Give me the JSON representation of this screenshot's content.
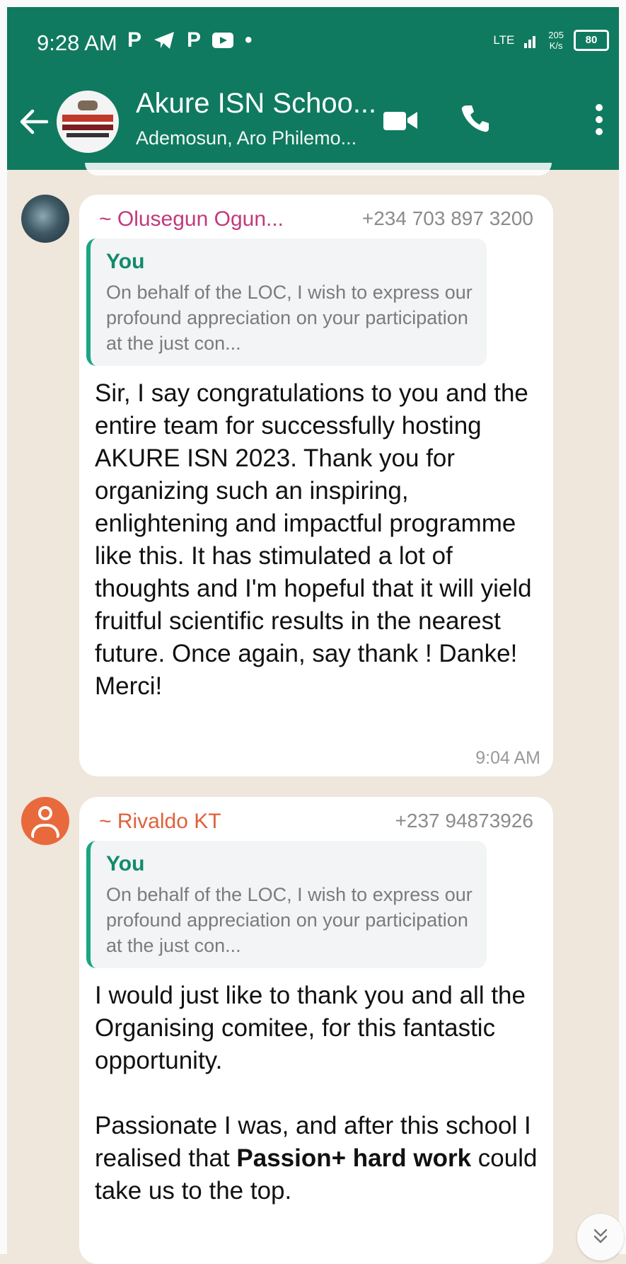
{
  "status_bar": {
    "time": "9:28 AM",
    "notif_p1": "P",
    "notif_p2": "P",
    "notif_dot": "•",
    "network": "LTE",
    "speed": "205",
    "speed_unit": "K/s",
    "battery": "80"
  },
  "chat": {
    "title": "Akure ISN Schoo...",
    "subtitle": "Ademosun, Aro Philemo..."
  },
  "messages": [
    {
      "sender": "~ Olusegun Ogun...",
      "phone": "+234 703 897 3200",
      "sender_color": "#c2397c",
      "quote_author": "You",
      "quote_text": "On behalf of the LOC, I wish to express our profound appreciation on your participation at the just con...",
      "body": "Sir, I say congratulations to you and the entire team for successfully  hosting AKURE ISN 2023. Thank you for organizing such an inspiring, enlightening and impactful programme like this. It has stimulated a lot of thoughts and I'm hopeful that it will yield fruitful scientific results in the nearest future. Once again, say thank ! Danke! Merci!",
      "time": "9:04 AM"
    },
    {
      "sender": "~ Rivaldo KT",
      "phone": "+237 94873926",
      "sender_color": "#e0613a",
      "quote_author": "You",
      "quote_text": "On behalf of the LOC, I wish to express our profound appreciation on your participation at the just con...",
      "body_para1": "I would just like to thank you and all the Organising comitee, for this fantastic opportunity.",
      "body_para2_a": "Passionate I was, and after this school I realised that ",
      "body_para2_bold": "Passion+ hard work",
      "body_para2_b": " could take us to the top."
    }
  ],
  "icons": {
    "back": "arrow-left-icon",
    "video": "video-call-icon",
    "call": "phone-icon",
    "more": "more-vertical-icon",
    "scroll": "chevron-double-down-icon"
  },
  "colors": {
    "header": "#0f7a5f",
    "background": "#efe6dc",
    "quote_bar": "#1aa683",
    "quote_author": "#138a6d"
  }
}
